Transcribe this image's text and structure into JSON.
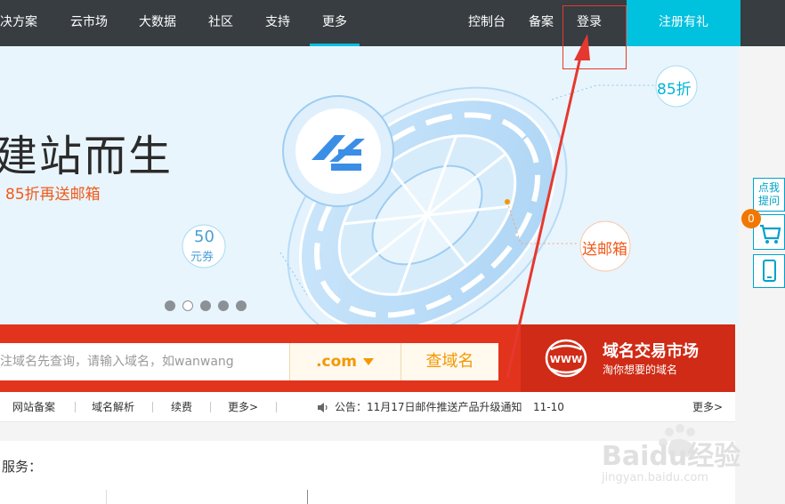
{
  "nav": {
    "items": [
      "决方案",
      "云市场",
      "大数据",
      "社区",
      "支持",
      "更多"
    ],
    "active_index": 5,
    "right_items": [
      "控制台",
      "备案",
      "登录"
    ],
    "register": "注册有礼"
  },
  "banner": {
    "headline": "建站而生",
    "subline": "85折再送邮箱",
    "tag_discount": "85折",
    "tag_coupon_value": "50",
    "tag_coupon_unit": "元券",
    "tag_email": "送邮箱",
    "carousel_count": 5,
    "carousel_active": 1
  },
  "float_tools": {
    "ask_line1": "点我",
    "ask_line2": "提问",
    "cart_count": "0"
  },
  "search": {
    "placeholder": "注域名先查询，请输入域名，如wanwang",
    "suffix": ".com",
    "button": "查域名",
    "market_title": "域名交易市场",
    "market_sub": "淘你想要的域名",
    "market_logo_text": "WWW"
  },
  "links": {
    "items": [
      "网站备案",
      "域名解析",
      "续费",
      "更多>"
    ],
    "notice": "公告：11月17日邮件推送产品升级通知",
    "notice_date": "11-10",
    "more": "更多>"
  },
  "services": {
    "label": "服务："
  },
  "watermark": {
    "brand": "Baidu经验",
    "url": "jingyan.baidu.com"
  },
  "colors": {
    "nav_bg": "#373d41",
    "accent": "#00c1de",
    "search_red": "#e2341d",
    "orange": "#f39800",
    "annotation": "#e5382f"
  }
}
